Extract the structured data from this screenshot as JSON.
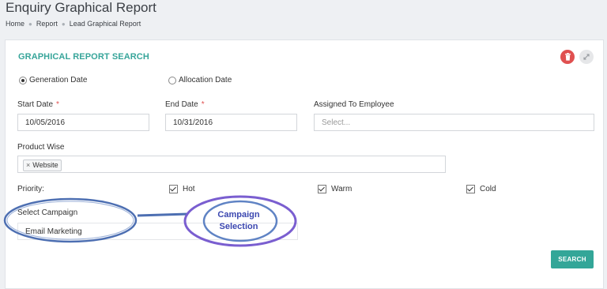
{
  "page": {
    "title": "Enquiry Graphical Report",
    "breadcrumb": [
      "Home",
      "Report",
      "Lead Graphical Report"
    ]
  },
  "panel": {
    "title": "GRAPHICAL REPORT SEARCH",
    "date_type": {
      "options": [
        "Generation Date",
        "Allocation Date"
      ],
      "selected": "Generation Date"
    },
    "start_date": {
      "label": "Start Date",
      "required_mark": "*",
      "value": "10/05/2016"
    },
    "end_date": {
      "label": "End Date",
      "required_mark": "*",
      "value": "10/31/2016"
    },
    "assigned_employee": {
      "label": "Assigned To Employee",
      "placeholder": "Select..."
    },
    "product_wise": {
      "label": "Product Wise",
      "tags": [
        {
          "remove": "×",
          "label": "Website"
        }
      ]
    },
    "priority": {
      "label": "Priority:",
      "options": [
        {
          "label": "Hot",
          "checked": true
        },
        {
          "label": "Warm",
          "checked": true
        },
        {
          "label": "Cold",
          "checked": true
        }
      ]
    },
    "campaign": {
      "label": "Select Campaign",
      "value": "Email Marketing"
    },
    "search_button": "SEARCH",
    "colors": {
      "accent": "#33a698",
      "delete": "#e05050",
      "required": "#e05050"
    },
    "icons": [
      "trash-icon",
      "expand-icon",
      "chip-remove-icon"
    ]
  },
  "annotation": {
    "callout_line1": "Campaign",
    "callout_line2": "Selection",
    "colors": {
      "outline": "#4d6fb2",
      "callout_ring": "#7a5ed0",
      "callout_text": "#3b47b0"
    }
  }
}
